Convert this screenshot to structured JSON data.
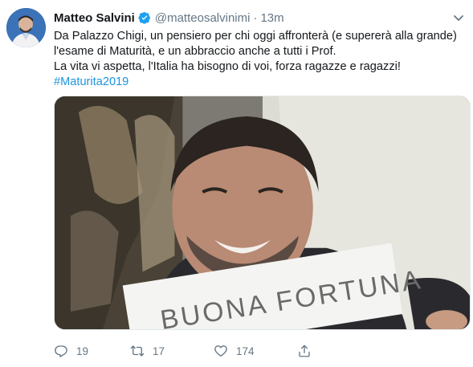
{
  "tweet": {
    "author_name": "Matteo Salvini",
    "author_handle": "@matteosalvinimi",
    "separator": "·",
    "timestamp": "13m",
    "text_lines": [
      "Da Palazzo Chigi, un pensiero per chi oggi affronterà (e supererà alla grande)",
      "l'esame di Maturità, e un abbraccio anche a tutti i Prof.",
      "La vita vi aspetta, l'Italia ha bisogno di voi, forza ragazze e ragazzi!"
    ],
    "hashtag": "#Maturita2019",
    "media_sign_text": "BUONA FORTUNA",
    "counts": {
      "replies": "19",
      "retweets": "17",
      "likes": "174"
    }
  },
  "icons": {
    "verified": "verified-badge-icon",
    "menu": "chevron-down-icon",
    "reply": "reply-icon",
    "retweet": "retweet-icon",
    "like": "heart-icon",
    "share": "share-icon"
  },
  "colors": {
    "accent": "#1da1f2",
    "hashtag": "#1b95e0",
    "secondary_text": "#657786",
    "primary_text": "#14171a"
  }
}
